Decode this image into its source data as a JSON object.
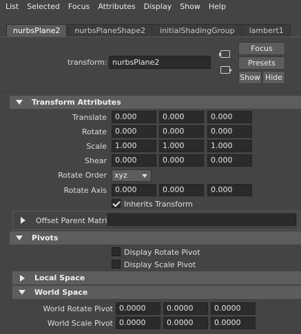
{
  "menu": [
    "List",
    "Selected",
    "Focus",
    "Attributes",
    "Display",
    "Show",
    "Help"
  ],
  "tabs": [
    {
      "label": "nurbsPlane2",
      "active": true
    },
    {
      "label": "nurbsPlaneShape2",
      "active": false
    },
    {
      "label": "initialShadingGroup",
      "active": false
    },
    {
      "label": "lambert1",
      "active": false
    }
  ],
  "header": {
    "transform_label": "transform:",
    "node_name": "nurbsPlane2",
    "buttons": {
      "focus": "Focus",
      "presets": "Presets",
      "show": "Show",
      "hide": "Hide"
    }
  },
  "transform_attributes": {
    "title": "Transform Attributes",
    "translate": {
      "label": "Translate",
      "values": [
        "0.000",
        "0.000",
        "0.000"
      ]
    },
    "rotate": {
      "label": "Rotate",
      "values": [
        "0.000",
        "0.000",
        "0.000"
      ]
    },
    "scale": {
      "label": "Scale",
      "values": [
        "1.000",
        "1.000",
        "1.000"
      ]
    },
    "shear": {
      "label": "Shear",
      "values": [
        "0.000",
        "0.000",
        "0.000"
      ]
    },
    "rotate_order": {
      "label": "Rotate Order",
      "value": "xyz"
    },
    "rotate_axis": {
      "label": "Rotate Axis",
      "values": [
        "0.000",
        "0.000",
        "0.000"
      ]
    },
    "inherits_transform": {
      "label": "Inherits Transform",
      "checked": true
    },
    "offset_parent_matrix": {
      "label": "Offset Parent Matrix"
    }
  },
  "pivots": {
    "title": "Pivots",
    "display_rotate_pivot": {
      "label": "Display Rotate Pivot",
      "checked": false
    },
    "display_scale_pivot": {
      "label": "Display Scale Pivot",
      "checked": false
    },
    "local_space": {
      "title": "Local Space"
    },
    "world_space": {
      "title": "World Space",
      "world_rotate_pivot": {
        "label": "World Rotate Pivot",
        "values": [
          "0.0000",
          "0.0000",
          "0.0000"
        ]
      },
      "world_scale_pivot": {
        "label": "World Scale Pivot",
        "values": [
          "0.0000",
          "0.0000",
          "0.0000"
        ]
      }
    }
  },
  "colors": {
    "background": "#444444",
    "section": "#5d5d5d",
    "field": "#2b2b2b"
  }
}
